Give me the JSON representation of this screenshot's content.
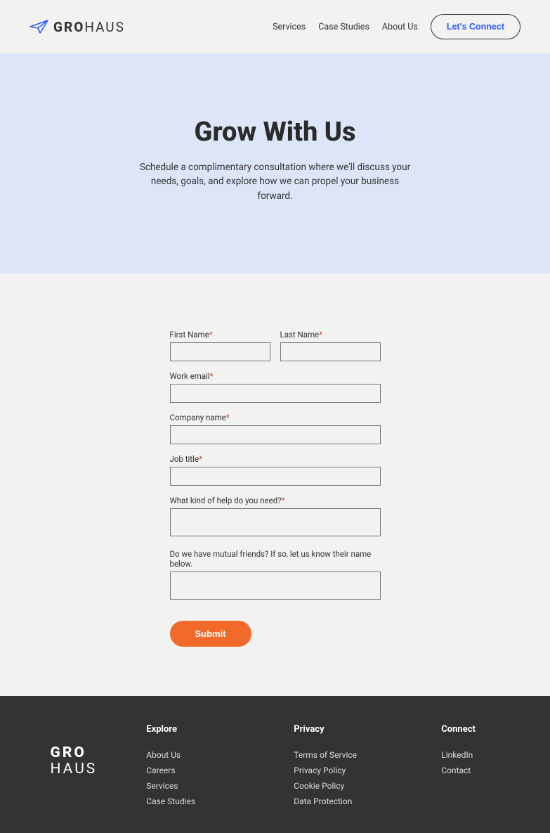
{
  "brand": {
    "part1": "GRO",
    "part2": "HAUS"
  },
  "nav": {
    "items": [
      {
        "label": "Services"
      },
      {
        "label": "Case Studies"
      },
      {
        "label": "About Us"
      }
    ],
    "cta": "Let's Connect"
  },
  "hero": {
    "title": "Grow With Us",
    "subtitle": "Schedule a complimentary consultation where we'll discuss your needs, goals, and explore how we can propel your business forward."
  },
  "form": {
    "first_name": {
      "label": "First Name",
      "required": true
    },
    "last_name": {
      "label": "Last Name",
      "required": true
    },
    "work_email": {
      "label": "Work email",
      "required": true
    },
    "company": {
      "label": "Company name",
      "required": true
    },
    "job_title": {
      "label": "Job title",
      "required": true
    },
    "help": {
      "label": "What kind of help do you need?",
      "required": true
    },
    "mutual": {
      "label": "Do we have mutual friends? If so, let us know their name below.",
      "required": false
    },
    "submit": "Submit",
    "required_marker": "*"
  },
  "footer": {
    "explore": {
      "heading": "Explore",
      "links": [
        "About Us",
        "Careers",
        "Services",
        "Case Studies"
      ]
    },
    "privacy": {
      "heading": "Privacy",
      "links": [
        "Terms of Service",
        "Privacy Policy",
        "Cookie Policy",
        "Data Protection"
      ]
    },
    "connect": {
      "heading": "Connect",
      "links": [
        "LinkedIn",
        "Contact"
      ]
    }
  }
}
